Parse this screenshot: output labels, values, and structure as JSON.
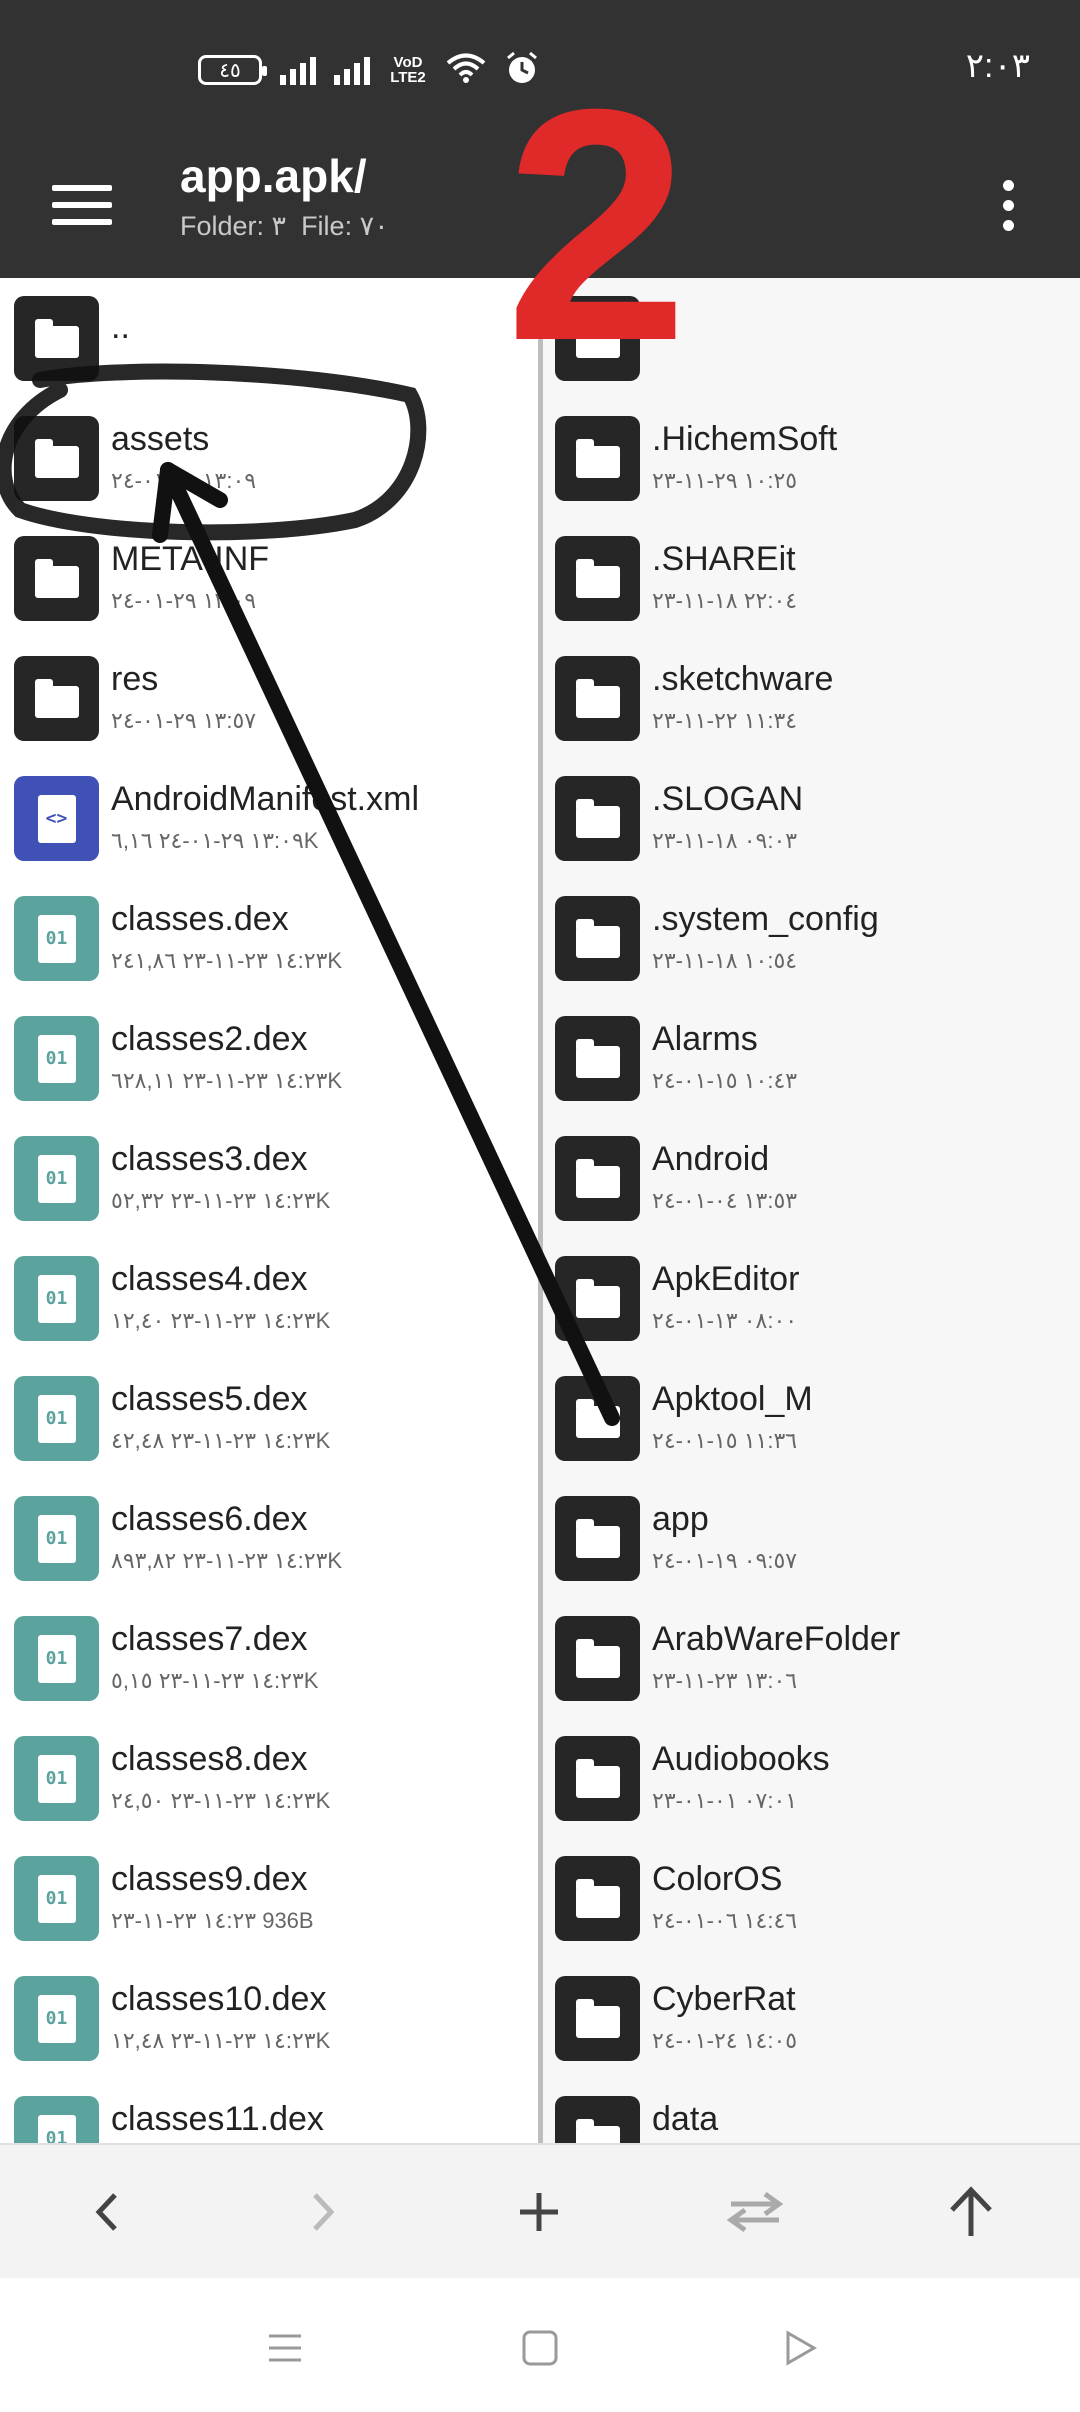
{
  "status_bar": {
    "battery": "٤٥",
    "network": "VoD LTE2",
    "time": "٢:٠٣"
  },
  "app_bar": {
    "title": "app.apk/",
    "subtitle": "Folder: ٣  File: ٧٠",
    "menu_icon": "hamburger-icon",
    "more_icon": "vertical-dots-icon"
  },
  "left_pane": {
    "items": [
      {
        "name": "..",
        "meta": "",
        "type": "folder"
      },
      {
        "name": "assets",
        "meta": "١٣:٠٩ ٢٩-٠١-٢٤",
        "type": "folder"
      },
      {
        "name": "META-INF",
        "meta": "١٣:٠٩ ٢٩-٠١-٢٤",
        "type": "folder"
      },
      {
        "name": "res",
        "meta": "١٣:٥٧ ٢٩-٠١-٢٤",
        "type": "folder"
      },
      {
        "name": "AndroidManifest.xml",
        "meta": "١٣:٠٩ ٢٩-٠١-٢٤   ٦,١٦K",
        "type": "xml"
      },
      {
        "name": "classes.dex",
        "meta": "١٤:٢٣ ٢٣-١١-٢٣   ٢٤١,٨٦K",
        "type": "dex"
      },
      {
        "name": "classes2.dex",
        "meta": "١٤:٢٣ ٢٣-١١-٢٣   ٦٢٨,١١K",
        "type": "dex"
      },
      {
        "name": "classes3.dex",
        "meta": "١٤:٢٣ ٢٣-١١-٢٣   ٥٢,٣٢K",
        "type": "dex"
      },
      {
        "name": "classes4.dex",
        "meta": "١٤:٢٣ ٢٣-١١-٢٣   ١٢,٤٠K",
        "type": "dex"
      },
      {
        "name": "classes5.dex",
        "meta": "١٤:٢٣ ٢٣-١١-٢٣   ٤٢,٤٨K",
        "type": "dex"
      },
      {
        "name": "classes6.dex",
        "meta": "١٤:٢٣ ٢٣-١١-٢٣   ٨٩٣,٨٢K",
        "type": "dex"
      },
      {
        "name": "classes7.dex",
        "meta": "١٤:٢٣ ٢٣-١١-٢٣   ٥,١٥K",
        "type": "dex"
      },
      {
        "name": "classes8.dex",
        "meta": "١٤:٢٣ ٢٣-١١-٢٣   ٢٤,٥٠K",
        "type": "dex"
      },
      {
        "name": "classes9.dex",
        "meta": "١٤:٢٣ ٢٣-١١-٢٣   936B",
        "type": "dex"
      },
      {
        "name": "classes10.dex",
        "meta": "١٤:٢٣ ٢٣-١١-٢٣   ١٢,٤٨K",
        "type": "dex"
      },
      {
        "name": "classes11.dex",
        "meta": "",
        "type": "dex"
      }
    ]
  },
  "right_pane": {
    "items": [
      {
        "name": "..",
        "meta": "",
        "type": "folder"
      },
      {
        "name": ".HichemSoft",
        "meta": "١٠:٢٥ ٢٩-١١-٢٣",
        "type": "folder"
      },
      {
        "name": ".SHAREit",
        "meta": "٢٢:٠٤ ١٨-١١-٢٣",
        "type": "folder"
      },
      {
        "name": ".sketchware",
        "meta": "١١:٣٤ ٢٢-١١-٢٣",
        "type": "folder"
      },
      {
        "name": ".SLOGAN",
        "meta": "٠٩:٠٣ ١٨-١١-٢٣",
        "type": "folder"
      },
      {
        "name": ".system_config",
        "meta": "١٠:٥٤ ١٨-١١-٢٣",
        "type": "folder"
      },
      {
        "name": "Alarms",
        "meta": "١٠:٤٣ ١٥-٠١-٢٤",
        "type": "folder"
      },
      {
        "name": "Android",
        "meta": "١٣:٥٣ ٠٤-٠١-٢٤",
        "type": "folder"
      },
      {
        "name": "ApkEditor",
        "meta": "٠٨:٠٠ ١٣-٠١-٢٤",
        "type": "folder"
      },
      {
        "name": "Apktool_M",
        "meta": "١١:٣٦ ١٥-٠١-٢٤",
        "type": "folder"
      },
      {
        "name": "app",
        "meta": "٠٩:٥٧ ١٩-٠١-٢٤",
        "type": "folder"
      },
      {
        "name": "ArabWareFolder",
        "meta": "١٣:٠٦ ٢٣-١١-٢٣",
        "type": "folder"
      },
      {
        "name": "Audiobooks",
        "meta": "٠٧:٠١ ٠١-٠١-٢٣",
        "type": "folder"
      },
      {
        "name": "ColorOS",
        "meta": "١٤:٤٦ ٠٦-٠١-٢٤",
        "type": "folder"
      },
      {
        "name": "CyberRat",
        "meta": "١٤:٠٥ ٢٤-٠١-٢٤",
        "type": "folder"
      },
      {
        "name": "data",
        "meta": "",
        "type": "folder"
      }
    ]
  },
  "toolbar": {
    "back_icon": "chevron-left-icon",
    "forward_icon": "chevron-right-icon",
    "add_icon": "plus-icon",
    "swap_icon": "swap-arrows-icon",
    "up_icon": "arrow-up-icon"
  },
  "nav_bar": {
    "menu_icon": "nav-menu-icon",
    "home_icon": "nav-home-icon",
    "back_icon": "nav-back-icon"
  },
  "annotations": {
    "step_number": "2",
    "step_color": "#e02a2a",
    "ink_color": "#111111"
  },
  "colors": {
    "app_bar": "#323232",
    "folder_icon": "#262626",
    "dex_icon": "#5ba39d",
    "xml_icon": "#3f51b5"
  }
}
